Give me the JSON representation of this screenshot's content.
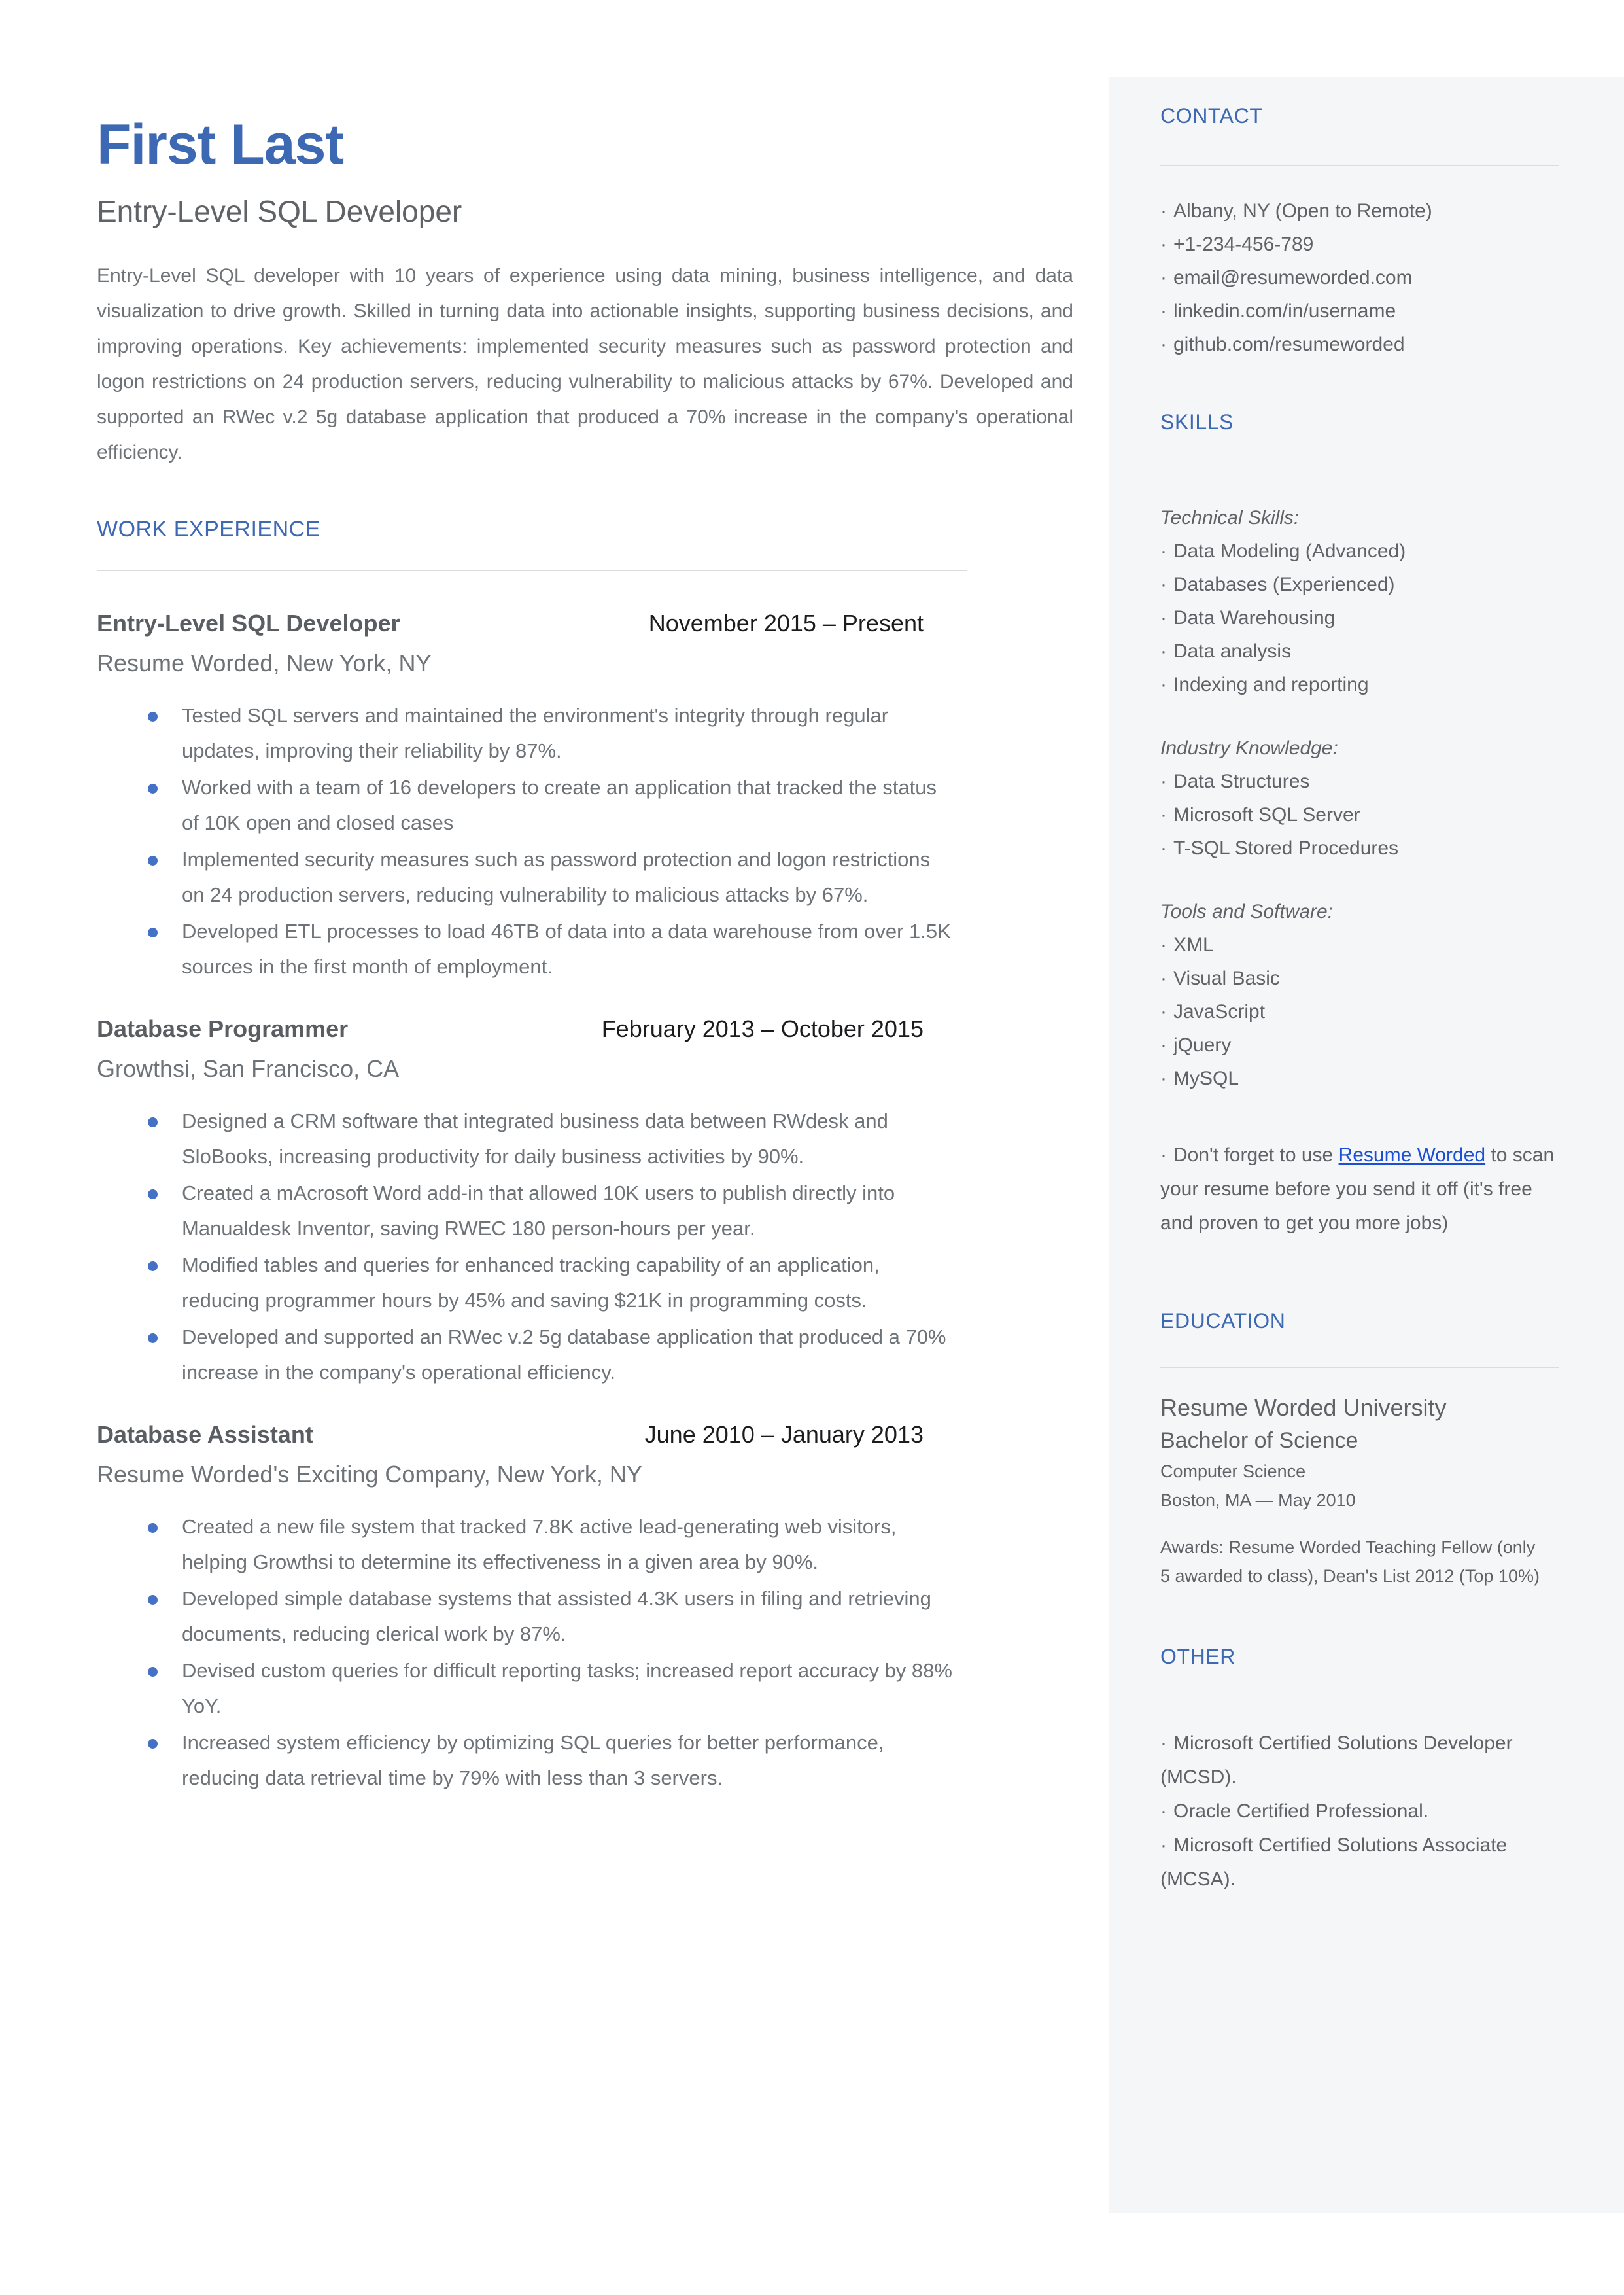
{
  "header": {
    "name": "First Last",
    "headline": "Entry-Level SQL Developer",
    "summary": "Entry-Level SQL developer with 10 years of experience using data mining, business intelligence, and data visualization to drive growth. Skilled in turning data into actionable insights, supporting business decisions, and improving operations. Key achievements: implemented security measures such as password protection and logon restrictions on 24 production servers, reducing vulnerability to malicious attacks by 67%. Developed and supported an RWec v.2 5g database application that produced a 70% increase in the company's operational efficiency."
  },
  "work": {
    "heading": "WORK EXPERIENCE",
    "jobs": [
      {
        "title": "Entry-Level SQL Developer",
        "dates": "November 2015 – Present",
        "company": "Resume Worded, New York, NY",
        "bullets": [
          "Tested SQL servers and maintained the environment's integrity through regular updates, improving their reliability by 87%.",
          "Worked with a team of 16 developers to create an application that tracked the status of 10K open and closed cases",
          "Implemented security measures such as password protection and logon restrictions on 24 production servers, reducing vulnerability to malicious attacks by 67%.",
          "Developed ETL processes to load 46TB of data into a data warehouse from over 1.5K sources in the first month of employment."
        ]
      },
      {
        "title": "Database Programmer",
        "dates": "February 2013 – October 2015",
        "company": "Growthsi, San Francisco, CA",
        "bullets": [
          "Designed a CRM software that integrated business data between RWdesk and SloBooks, increasing productivity for daily business activities by 90%.",
          "Created a mAcrosoft Word add-in that allowed 10K users to publish directly into Manualdesk Inventor, saving RWEC 180 person-hours per year.",
          "Modified tables and queries for enhanced tracking capability of an application, reducing programmer hours by 45% and saving $21K in programming costs.",
          "Developed and supported an RWec v.2 5g database application that produced a 70% increase in the company's operational efficiency."
        ]
      },
      {
        "title": "Database Assistant",
        "dates": "June 2010 – January 2013",
        "company": "Resume Worded's Exciting Company, New York, NY",
        "bullets": [
          "Created a new file system that tracked 7.8K active lead-generating web visitors, helping Growthsi to determine its effectiveness in a given area by 90%.",
          "Developed simple database systems that assisted 4.3K users in filing and retrieving documents, reducing clerical work by 87%.",
          "Devised custom queries for difficult reporting tasks; increased report accuracy by 88% YoY.",
          "Increased system efficiency by optimizing SQL queries for better performance, reducing data retrieval time by 79% with less than 3 servers."
        ]
      }
    ]
  },
  "contact": {
    "heading": "CONTACT",
    "items": [
      "Albany, NY (Open to Remote)",
      "+1-234-456-789",
      "email@resumeworded.com",
      "linkedin.com/in/username",
      "github.com/resumeworded"
    ]
  },
  "skills": {
    "heading": "SKILLS",
    "groups": [
      {
        "label": "Technical Skills:",
        "items": [
          "Data Modeling (Advanced)",
          "Databases (Experienced)",
          "Data Warehousing",
          "Data analysis",
          "Indexing and reporting"
        ]
      },
      {
        "label": "Industry Knowledge:",
        "items": [
          "Data Structures",
          "Microsoft SQL Server",
          "T-SQL Stored Procedures"
        ]
      },
      {
        "label": "Tools and Software:",
        "items": [
          "XML",
          "Visual Basic",
          "JavaScript",
          "jQuery",
          "MySQL"
        ]
      }
    ],
    "promo": {
      "before": "Don't forget to use ",
      "link": "Resume Worded",
      "after": " to scan your resume before you send it off (it's free and proven to get you more jobs)"
    }
  },
  "education": {
    "heading": "EDUCATION",
    "school": "Resume Worded University",
    "degree": "Bachelor of Science",
    "field": "Computer Science",
    "location": "Boston, MA — May 2010",
    "awards": "Awards: Resume Worded Teaching Fellow (only 5 awarded to class), Dean's List 2012 (Top 10%)"
  },
  "other": {
    "heading": "OTHER",
    "items": [
      "Microsoft Certified Solutions Developer (MCSD).",
      "Oracle Certified Professional.",
      "Microsoft Certified Solutions Associate (MCSA)."
    ]
  },
  "colors": {
    "accent": "#3d68b3",
    "bullet": "#4471c4",
    "link": "#1a4fd6",
    "body_text": "#6e7378",
    "sidebar_bg": "#f5f6f8"
  }
}
